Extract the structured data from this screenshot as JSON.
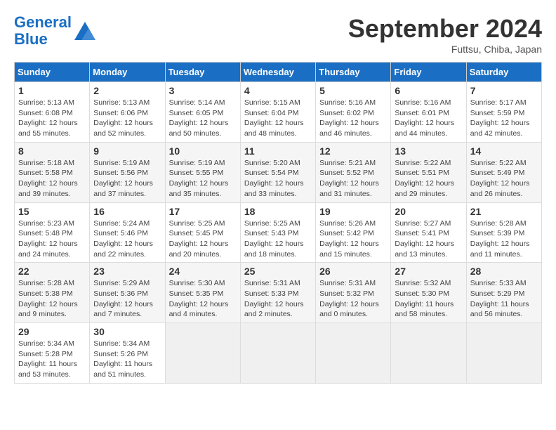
{
  "header": {
    "logo_line1": "General",
    "logo_line2": "Blue",
    "month": "September 2024",
    "location": "Futtsu, Chiba, Japan"
  },
  "weekdays": [
    "Sunday",
    "Monday",
    "Tuesday",
    "Wednesday",
    "Thursday",
    "Friday",
    "Saturday"
  ],
  "weeks": [
    [
      {
        "day": "1",
        "info": "Sunrise: 5:13 AM\nSunset: 6:08 PM\nDaylight: 12 hours\nand 55 minutes."
      },
      {
        "day": "2",
        "info": "Sunrise: 5:13 AM\nSunset: 6:06 PM\nDaylight: 12 hours\nand 52 minutes."
      },
      {
        "day": "3",
        "info": "Sunrise: 5:14 AM\nSunset: 6:05 PM\nDaylight: 12 hours\nand 50 minutes."
      },
      {
        "day": "4",
        "info": "Sunrise: 5:15 AM\nSunset: 6:04 PM\nDaylight: 12 hours\nand 48 minutes."
      },
      {
        "day": "5",
        "info": "Sunrise: 5:16 AM\nSunset: 6:02 PM\nDaylight: 12 hours\nand 46 minutes."
      },
      {
        "day": "6",
        "info": "Sunrise: 5:16 AM\nSunset: 6:01 PM\nDaylight: 12 hours\nand 44 minutes."
      },
      {
        "day": "7",
        "info": "Sunrise: 5:17 AM\nSunset: 5:59 PM\nDaylight: 12 hours\nand 42 minutes."
      }
    ],
    [
      {
        "day": "8",
        "info": "Sunrise: 5:18 AM\nSunset: 5:58 PM\nDaylight: 12 hours\nand 39 minutes."
      },
      {
        "day": "9",
        "info": "Sunrise: 5:19 AM\nSunset: 5:56 PM\nDaylight: 12 hours\nand 37 minutes."
      },
      {
        "day": "10",
        "info": "Sunrise: 5:19 AM\nSunset: 5:55 PM\nDaylight: 12 hours\nand 35 minutes."
      },
      {
        "day": "11",
        "info": "Sunrise: 5:20 AM\nSunset: 5:54 PM\nDaylight: 12 hours\nand 33 minutes."
      },
      {
        "day": "12",
        "info": "Sunrise: 5:21 AM\nSunset: 5:52 PM\nDaylight: 12 hours\nand 31 minutes."
      },
      {
        "day": "13",
        "info": "Sunrise: 5:22 AM\nSunset: 5:51 PM\nDaylight: 12 hours\nand 29 minutes."
      },
      {
        "day": "14",
        "info": "Sunrise: 5:22 AM\nSunset: 5:49 PM\nDaylight: 12 hours\nand 26 minutes."
      }
    ],
    [
      {
        "day": "15",
        "info": "Sunrise: 5:23 AM\nSunset: 5:48 PM\nDaylight: 12 hours\nand 24 minutes."
      },
      {
        "day": "16",
        "info": "Sunrise: 5:24 AM\nSunset: 5:46 PM\nDaylight: 12 hours\nand 22 minutes."
      },
      {
        "day": "17",
        "info": "Sunrise: 5:25 AM\nSunset: 5:45 PM\nDaylight: 12 hours\nand 20 minutes."
      },
      {
        "day": "18",
        "info": "Sunrise: 5:25 AM\nSunset: 5:43 PM\nDaylight: 12 hours\nand 18 minutes."
      },
      {
        "day": "19",
        "info": "Sunrise: 5:26 AM\nSunset: 5:42 PM\nDaylight: 12 hours\nand 15 minutes."
      },
      {
        "day": "20",
        "info": "Sunrise: 5:27 AM\nSunset: 5:41 PM\nDaylight: 12 hours\nand 13 minutes."
      },
      {
        "day": "21",
        "info": "Sunrise: 5:28 AM\nSunset: 5:39 PM\nDaylight: 12 hours\nand 11 minutes."
      }
    ],
    [
      {
        "day": "22",
        "info": "Sunrise: 5:28 AM\nSunset: 5:38 PM\nDaylight: 12 hours\nand 9 minutes."
      },
      {
        "day": "23",
        "info": "Sunrise: 5:29 AM\nSunset: 5:36 PM\nDaylight: 12 hours\nand 7 minutes."
      },
      {
        "day": "24",
        "info": "Sunrise: 5:30 AM\nSunset: 5:35 PM\nDaylight: 12 hours\nand 4 minutes."
      },
      {
        "day": "25",
        "info": "Sunrise: 5:31 AM\nSunset: 5:33 PM\nDaylight: 12 hours\nand 2 minutes."
      },
      {
        "day": "26",
        "info": "Sunrise: 5:31 AM\nSunset: 5:32 PM\nDaylight: 12 hours\nand 0 minutes."
      },
      {
        "day": "27",
        "info": "Sunrise: 5:32 AM\nSunset: 5:30 PM\nDaylight: 11 hours\nand 58 minutes."
      },
      {
        "day": "28",
        "info": "Sunrise: 5:33 AM\nSunset: 5:29 PM\nDaylight: 11 hours\nand 56 minutes."
      }
    ],
    [
      {
        "day": "29",
        "info": "Sunrise: 5:34 AM\nSunset: 5:28 PM\nDaylight: 11 hours\nand 53 minutes."
      },
      {
        "day": "30",
        "info": "Sunrise: 5:34 AM\nSunset: 5:26 PM\nDaylight: 11 hours\nand 51 minutes."
      },
      {
        "day": "",
        "info": ""
      },
      {
        "day": "",
        "info": ""
      },
      {
        "day": "",
        "info": ""
      },
      {
        "day": "",
        "info": ""
      },
      {
        "day": "",
        "info": ""
      }
    ]
  ]
}
